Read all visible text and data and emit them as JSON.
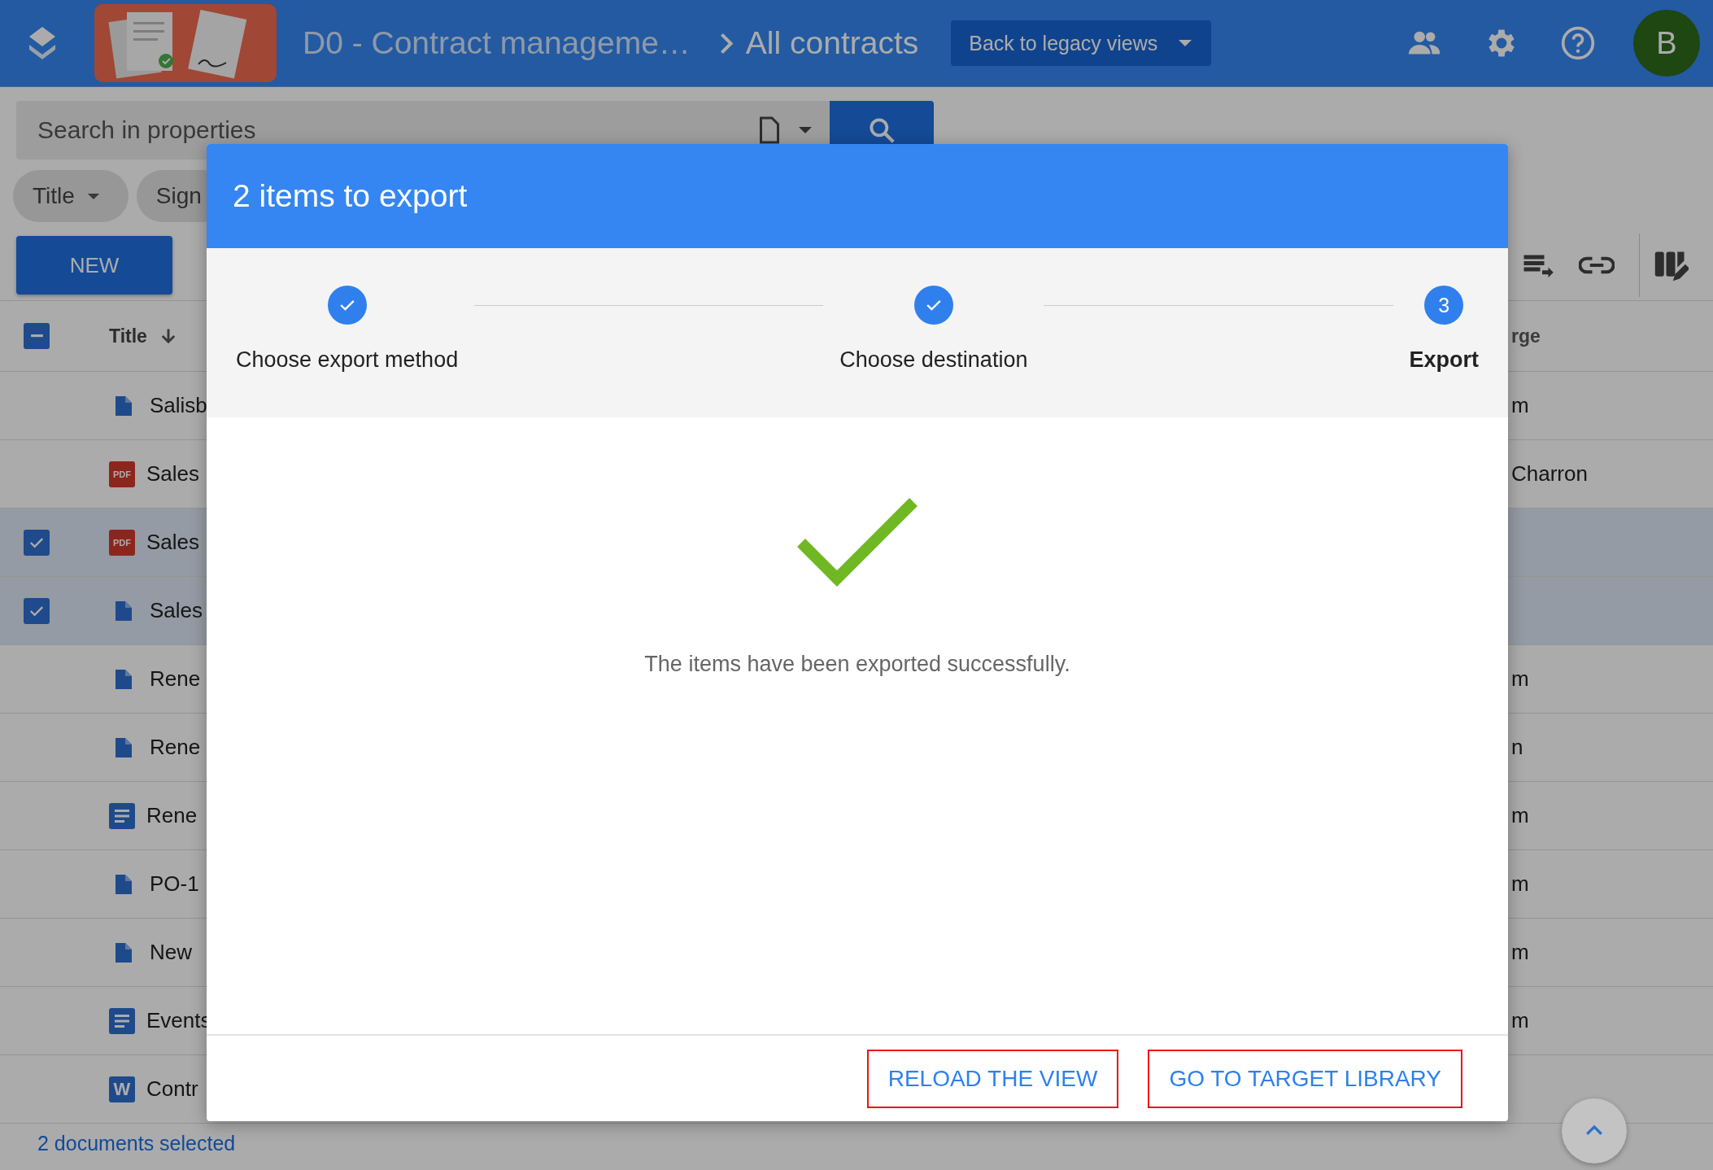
{
  "header": {
    "app_title": "D0 - Contract manageme…",
    "current_view": "All contracts",
    "legacy_button": "Back to legacy views",
    "avatar": "B"
  },
  "search": {
    "placeholder": "Search in properties"
  },
  "filters": [
    {
      "label": "Title"
    },
    {
      "label": "Sign"
    }
  ],
  "new_button": "NEW",
  "table": {
    "select_all": {
      "indeterminate": true
    },
    "columns": [
      {
        "label": "Title",
        "sorted": true
      },
      {
        "label": "rge",
        "sorted": false
      }
    ],
    "rows": [
      {
        "kind": "doc",
        "title": "Salisb",
        "column_last": "m",
        "selected": false
      },
      {
        "kind": "pdf",
        "icon_text": "PDF",
        "title": "Sales",
        "column_last": "Charron",
        "selected": false
      },
      {
        "kind": "pdf",
        "icon_text": "PDF",
        "title": "Sales",
        "selected": true
      },
      {
        "kind": "doc",
        "title": "Sales",
        "selected": true
      },
      {
        "kind": "doc",
        "title": "Rene",
        "column_last": "m",
        "selected": false
      },
      {
        "kind": "doc",
        "title": "Rene",
        "column_last": "n",
        "selected": false
      },
      {
        "kind": "text",
        "title": "Rene",
        "column_last": "m",
        "selected": false
      },
      {
        "kind": "doc",
        "title": "PO-1",
        "column_last": "m",
        "selected": false
      },
      {
        "kind": "doc",
        "title": "New",
        "column_last": "m",
        "selected": false
      },
      {
        "kind": "text",
        "title": "Events",
        "column_last": "m",
        "selected": false
      },
      {
        "kind": "word",
        "icon_text": "W",
        "title": "Contr",
        "selected": false
      }
    ]
  },
  "selection_status": "2 documents selected",
  "dialog": {
    "title": "2 items to export",
    "steps": [
      {
        "label": "Choose export method",
        "completed": true,
        "active": false
      },
      {
        "label": "Choose destination",
        "completed": true,
        "active": false
      },
      {
        "number": "3",
        "label": "Export",
        "completed": false,
        "active": true
      }
    ],
    "message": "The items have been exported successfully.",
    "buttons": [
      {
        "label": "RELOAD THE VIEW",
        "highlighted": true
      },
      {
        "label": "GO TO TARGET LIBRARY",
        "highlighted": true
      }
    ]
  }
}
